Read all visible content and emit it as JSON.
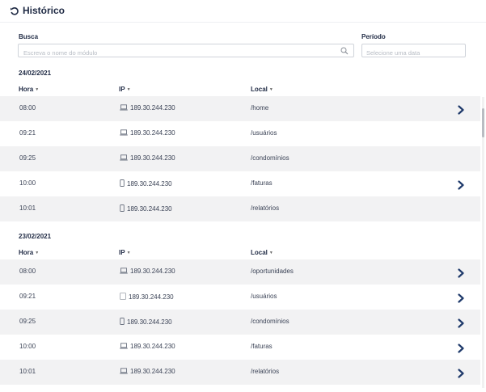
{
  "header": {
    "title": "Histórico",
    "back_icon": "history-back-icon"
  },
  "filters": {
    "search_label": "Busca",
    "search_placeholder": "Escreva o nome do módulo",
    "period_label": "Período",
    "period_placeholder": "Selecione uma data"
  },
  "columns": {
    "hora": "Hora",
    "ip": "IP",
    "local": "Local"
  },
  "colors": {
    "primary": "#1f2a44",
    "row_shade": "#f2f2f3",
    "chevron": "#1f3a6b"
  },
  "groups": [
    {
      "date": "24/02/2021",
      "rows": [
        {
          "hora": "08:00",
          "device": "laptop-icon",
          "ip": "189.30.244.230",
          "local": "/home",
          "chevron": true
        },
        {
          "hora": "09:21",
          "device": "laptop-icon",
          "ip": "189.30.244.230",
          "local": "/usuários",
          "chevron": false
        },
        {
          "hora": "09:25",
          "device": "laptop-icon",
          "ip": "189.30.244.230",
          "local": "/condomínios",
          "chevron": false
        },
        {
          "hora": "10:00",
          "device": "mobile-icon",
          "ip": "189.30.244.230",
          "local": "/faturas",
          "chevron": true
        },
        {
          "hora": "10:01",
          "device": "mobile-icon",
          "ip": "189.30.244.230",
          "local": "/relatórios",
          "chevron": false
        }
      ]
    },
    {
      "date": "23/02/2021",
      "rows": [
        {
          "hora": "08:00",
          "device": "laptop-icon",
          "ip": "189.30.244.230",
          "local": "/oportunidades",
          "chevron": true
        },
        {
          "hora": "09:21",
          "device": "tablet-icon",
          "ip": "189.30.244.230",
          "local": "/usuários",
          "chevron": true
        },
        {
          "hora": "09:25",
          "device": "mobile-icon",
          "ip": "189.30.244.230",
          "local": "/condomínios",
          "chevron": true
        },
        {
          "hora": "10:00",
          "device": "laptop-icon",
          "ip": "189.30.244.230",
          "local": "/faturas",
          "chevron": true
        },
        {
          "hora": "10:01",
          "device": "laptop-icon",
          "ip": "189.30.244.230",
          "local": "/relatórios",
          "chevron": true
        }
      ]
    }
  ]
}
